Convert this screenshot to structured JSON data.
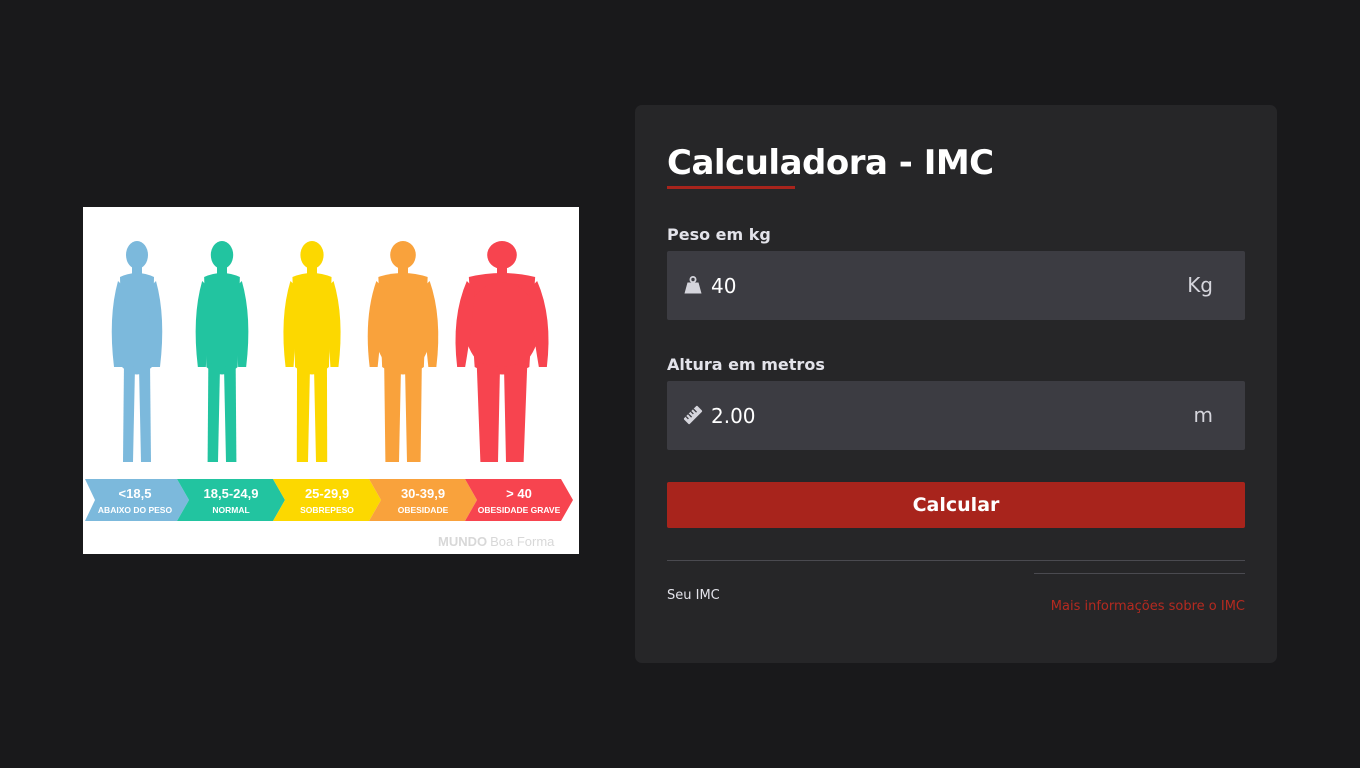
{
  "illustration": {
    "categories": [
      {
        "range": "<18,5",
        "label": "ABAIXO DO PESO",
        "color": "#7cb9dc"
      },
      {
        "range": "18,5-24,9",
        "label": "NORMAL",
        "color": "#22c4a0"
      },
      {
        "range": "25-29,9",
        "label": "SOBREPESO",
        "color": "#fcd800"
      },
      {
        "range": "30-39,9",
        "label": "OBESIDADE",
        "color": "#f9a23c"
      },
      {
        "range": "> 40",
        "label": "OBESIDADE GRAVE",
        "color": "#f7444f"
      }
    ],
    "watermark_bold": "MUNDO",
    "watermark_light": "Boa Forma"
  },
  "calculator": {
    "title": "Calculadora - IMC",
    "weight": {
      "label": "Peso em kg",
      "value": "40",
      "unit": "Kg",
      "icon": "weight-icon"
    },
    "height": {
      "label": "Altura em metros",
      "value": "2.00",
      "unit": "m",
      "icon": "ruler-icon"
    },
    "button_label": "Calcular",
    "result_label": "Seu IMC",
    "result_value": "",
    "more_info_link": "Mais informações sobre o IMC"
  },
  "colors": {
    "background": "#19191b",
    "card": "#262628",
    "field": "#3c3c42",
    "accent": "#a8241c",
    "link": "#b52a20"
  }
}
